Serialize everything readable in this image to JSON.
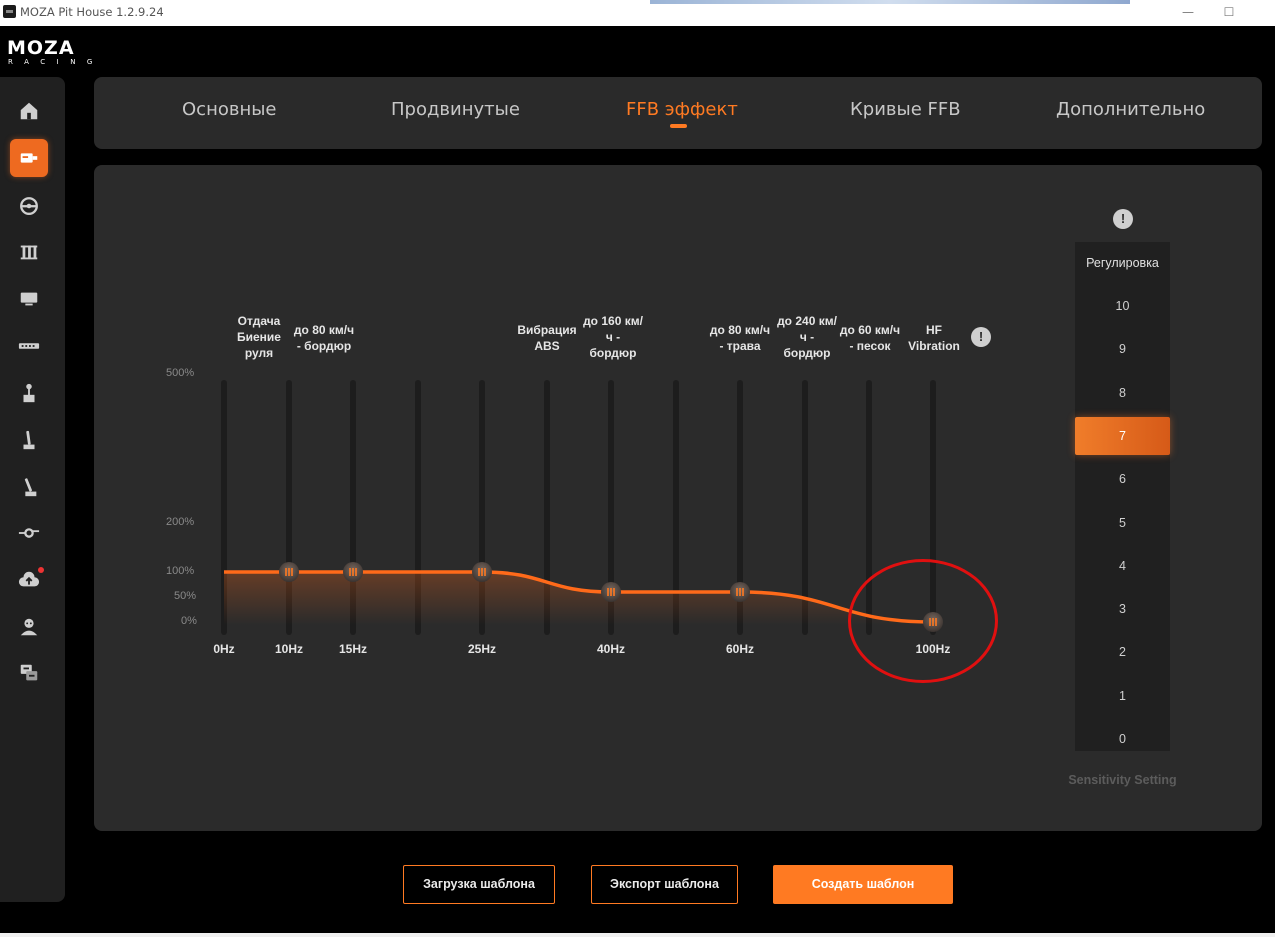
{
  "window": {
    "title": "MOZA Pit House 1.2.9.24",
    "minimize": "—",
    "maximize": "☐"
  },
  "logo": {
    "word": "MOZA",
    "sub": "RACING"
  },
  "sidebar": {
    "items": [
      {
        "name": "home-icon"
      },
      {
        "name": "wheelbase-icon",
        "active": true
      },
      {
        "name": "steering-wheel-icon"
      },
      {
        "name": "pedals-icon"
      },
      {
        "name": "dashboard-icon"
      },
      {
        "name": "display-bar-icon"
      },
      {
        "name": "shifter-icon"
      },
      {
        "name": "handbrake-icon"
      },
      {
        "name": "sequential-shifter-icon"
      },
      {
        "name": "hub-icon"
      },
      {
        "name": "cloud-icon",
        "badge": true
      },
      {
        "name": "user-icon"
      },
      {
        "name": "language-icon"
      }
    ]
  },
  "tabs": [
    {
      "label": "Основные"
    },
    {
      "label": "Продвинутые"
    },
    {
      "label": "FFB эффект",
      "active": true
    },
    {
      "label": "Кривые FFB"
    },
    {
      "label": "Дополнительно"
    }
  ],
  "chart_data": {
    "type": "line",
    "yticks": [
      "500%",
      "200%",
      "100%",
      "50%",
      "0%"
    ],
    "x": [
      "0Hz",
      "10Hz",
      "15Hz",
      "25Hz",
      "40Hz",
      "60Hz",
      "100Hz"
    ],
    "values": [
      100,
      100,
      100,
      100,
      60,
      60,
      0
    ],
    "band_labels": [
      "Отдача\nБиение\nруля",
      "до 80 км/ч\n- бордюр",
      "Вибрация\nABS",
      "до 160 км/\nч -\nбордюр",
      "до 80 км/ч\n- трава",
      "до 240 км/\nч -\nбордюр",
      "до 60 км/ч\n- песок",
      "HF\nVibration"
    ],
    "accent_color": "#ff7a22"
  },
  "sensitivity": {
    "title": "Регулировка",
    "levels": [
      "10",
      "9",
      "8",
      "7",
      "6",
      "5",
      "4",
      "3",
      "2",
      "1",
      "0"
    ],
    "selected": "7",
    "caption": "Sensitivity Setting"
  },
  "buttons": {
    "load_template": "Загрузка шаблона",
    "export_template": "Экспорт шаблона",
    "create_template": "Создать шаблон"
  }
}
